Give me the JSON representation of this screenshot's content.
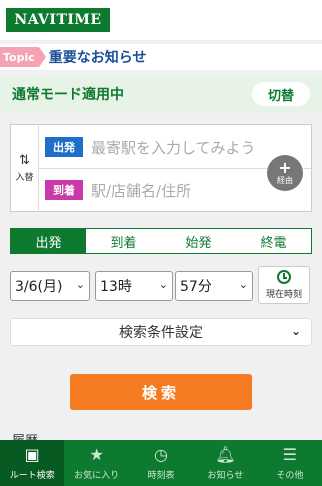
{
  "header": {
    "logo": "NAVITIME"
  },
  "topic": {
    "badge": "Topic",
    "text": "重要なお知らせ"
  },
  "mode": {
    "text": "通常モード適用中",
    "switch_label": "切替"
  },
  "route": {
    "swap_label": "入替",
    "from_tag": "出発",
    "from_placeholder": "最寄駅を入力してみよう",
    "to_tag": "到着",
    "to_placeholder": "駅/店舗名/住所",
    "via_label": "経由"
  },
  "tabs": [
    {
      "label": "出発",
      "active": true
    },
    {
      "label": "到着"
    },
    {
      "label": "始発"
    },
    {
      "label": "終電"
    }
  ],
  "datetime": {
    "date": "3/6(月)",
    "hour": "13時",
    "minute": "57分",
    "now_label": "現在時刻"
  },
  "conditions": {
    "label": "検索条件設定"
  },
  "search": {
    "label": "検索"
  },
  "history": {
    "label": "履歴"
  },
  "bottom_nav": [
    {
      "label": "ルート検索",
      "icon": "map-icon"
    },
    {
      "label": "お気に入り",
      "icon": "star-icon"
    },
    {
      "label": "時刻表",
      "icon": "clock-icon"
    },
    {
      "label": "お知らせ",
      "icon": "bell-icon"
    },
    {
      "label": "その他",
      "icon": "menu-icon"
    }
  ],
  "colors": {
    "brand": "#0e7a2f",
    "accent": "#f47b20",
    "from_tag": "#1e6fc9",
    "to_tag": "#c93aa8",
    "topic_badge": "#f5a3b2"
  }
}
